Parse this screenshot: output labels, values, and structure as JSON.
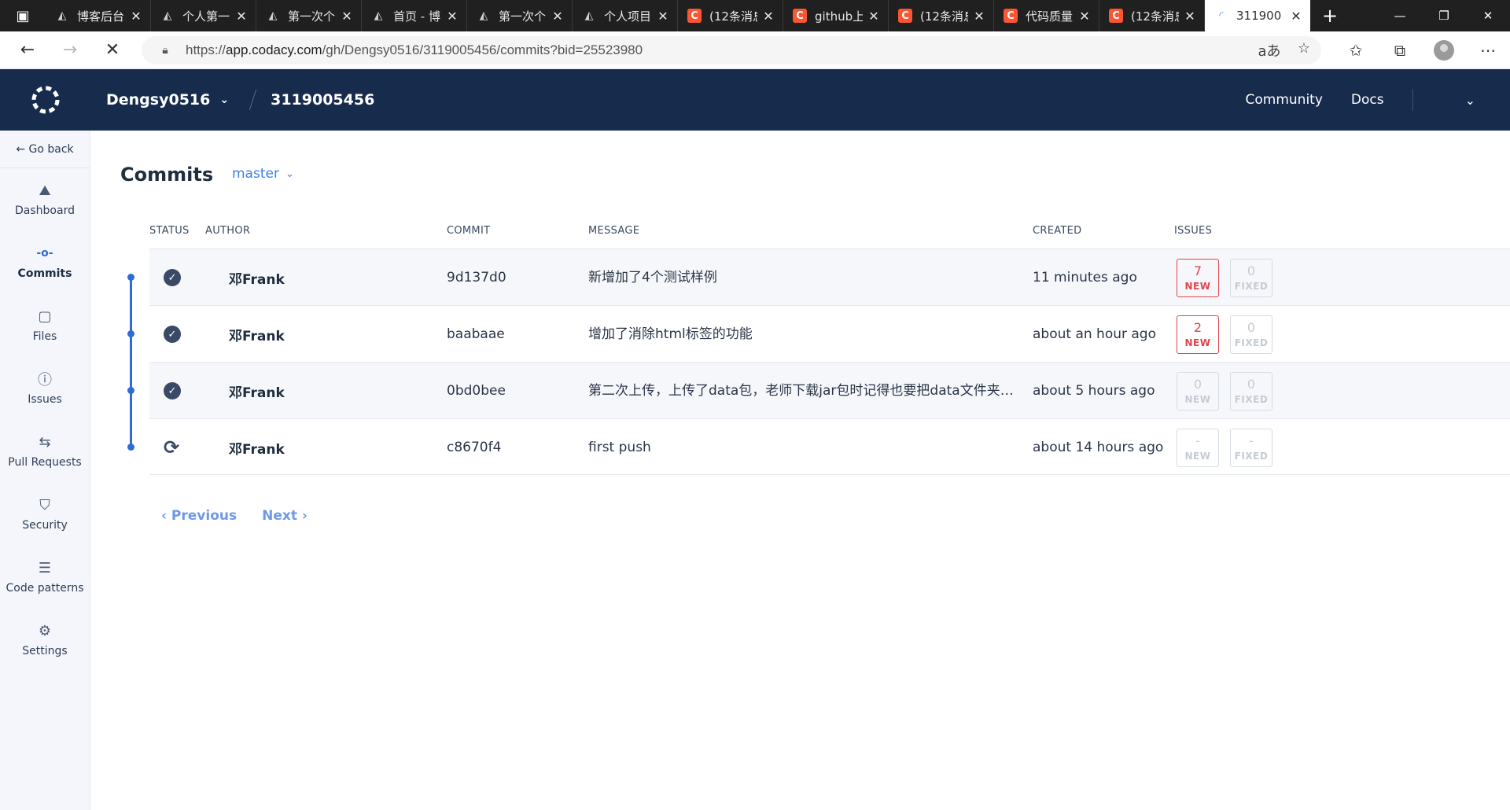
{
  "browser": {
    "tabs": [
      {
        "icon": "cnblogs",
        "title": "博客后台"
      },
      {
        "icon": "cnblogs",
        "title": "个人第一"
      },
      {
        "icon": "cnblogs",
        "title": "第一次个"
      },
      {
        "icon": "cnblogs",
        "title": "首页 - 博"
      },
      {
        "icon": "cnblogs",
        "title": "第一次个"
      },
      {
        "icon": "cnblogs",
        "title": "个人项目"
      },
      {
        "icon": "csdn",
        "title": "(12条消息"
      },
      {
        "icon": "csdn",
        "title": "github上"
      },
      {
        "icon": "csdn",
        "title": "(12条消息"
      },
      {
        "icon": "csdn",
        "title": "代码质量"
      },
      {
        "icon": "csdn",
        "title": "(12条消息"
      },
      {
        "icon": "codacy",
        "title": "311900",
        "active": true
      }
    ],
    "url_prefix": "https://",
    "url_host": "app.codacy.com",
    "url_path": "/gh/Dengsy0516/3119005456/commits?bid=25523980"
  },
  "header": {
    "org": "Dengsy0516",
    "repo": "3119005456",
    "links": [
      "Community",
      "Docs"
    ]
  },
  "sidebar": {
    "go_back": "← Go back",
    "items": [
      {
        "label": "Dashboard",
        "icon": "dashboard-icon",
        "active": false
      },
      {
        "label": "Commits",
        "icon": "commits-icon",
        "active": true
      },
      {
        "label": "Files",
        "icon": "files-icon",
        "active": false
      },
      {
        "label": "Issues",
        "icon": "issues-icon",
        "active": false
      },
      {
        "label": "Pull Requests",
        "icon": "pull-requests-icon",
        "active": false
      },
      {
        "label": "Security",
        "icon": "security-icon",
        "active": false
      },
      {
        "label": "Code patterns",
        "icon": "code-patterns-icon",
        "active": false
      },
      {
        "label": "Settings",
        "icon": "settings-icon",
        "active": false
      }
    ]
  },
  "main": {
    "title": "Commits",
    "branch": "master",
    "columns": [
      "STATUS",
      "AUTHOR",
      "COMMIT",
      "MESSAGE",
      "CREATED",
      "ISSUES"
    ],
    "commits": [
      {
        "status": "done",
        "author": "邓Frank",
        "commit": "9d137d0",
        "message": "新增加了4个测试样例",
        "created": "11 minutes ago",
        "new": "7",
        "fixed": "0"
      },
      {
        "status": "done",
        "author": "邓Frank",
        "commit": "baabaae",
        "message": "增加了消除html标签的功能",
        "created": "about an hour ago",
        "new": "2",
        "fixed": "0"
      },
      {
        "status": "done",
        "author": "邓Frank",
        "commit": "0bd0bee",
        "message": "第二次上传，上传了data包，老师下载jar包时记得也要把data文件夹一起下载",
        "created": "about 5 hours ago",
        "new": "0",
        "fixed": "0"
      },
      {
        "status": "syncing",
        "author": "邓Frank",
        "commit": "c8670f4",
        "message": "first push",
        "created": "about 14 hours ago",
        "new": "-",
        "fixed": "-"
      }
    ],
    "new_label": "NEW",
    "fixed_label": "FIXED",
    "pager": {
      "previous": "‹ Previous",
      "next": "Next ›"
    }
  },
  "colors": {
    "header_bg": "#172b4d",
    "accent": "#2f6bd7",
    "issue_new": "#e0454c"
  }
}
